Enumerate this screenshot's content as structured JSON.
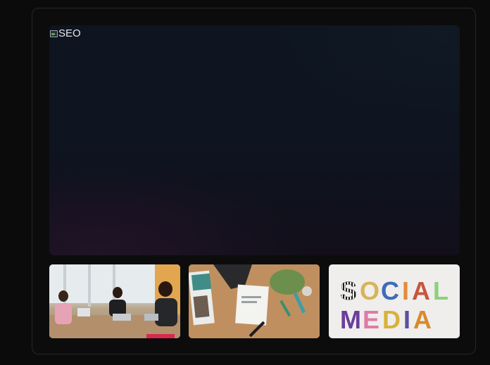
{
  "gallery": {
    "main_image": {
      "alt": "SEO"
    },
    "thumbnails": [
      {
        "label": "team meeting"
      },
      {
        "label": "marketing desk"
      },
      {
        "label": "social media letters"
      }
    ],
    "social_media_text": {
      "line1": "SOCIAL",
      "line2": "MEDIA"
    }
  }
}
